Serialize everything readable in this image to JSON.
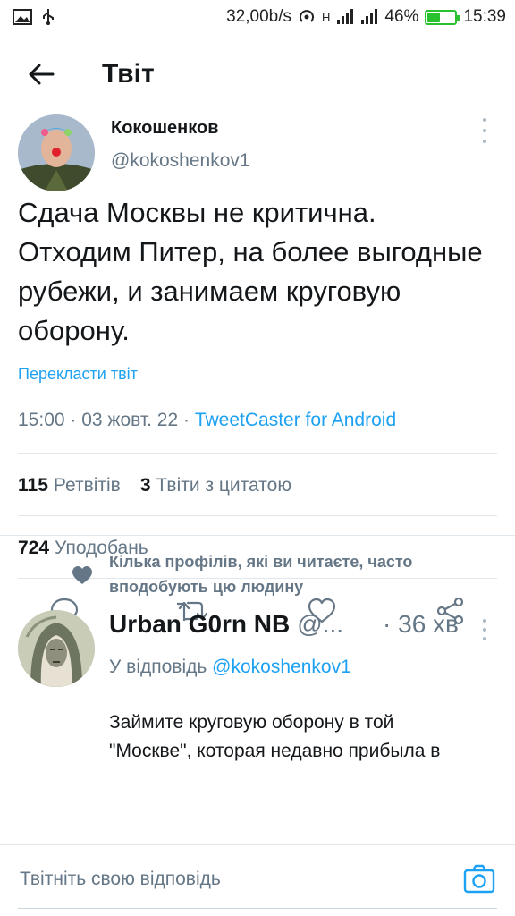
{
  "status_bar": {
    "speed": "32,00b/s",
    "network": "H",
    "battery_percent": "46%",
    "battery_level": 0.46,
    "time": "15:39"
  },
  "header": {
    "title": "Твіт"
  },
  "tweet": {
    "author_name": "Кокошенков",
    "author_handle": "@kokoshenkov1",
    "text": "Сдача Москвы не критична.\nОтходим Питер, на более выгодные рубежи, и занимаем круговую оборону.",
    "translate_label": "Перекласти твіт",
    "time": "15:00",
    "date": "03 жовт. 22",
    "separator": " · ",
    "client": "TweetCaster for Android",
    "retweets_count": "115",
    "retweets_label": "Ретвітів",
    "quotes_count": "3",
    "quotes_label": "Твіти з цитатою",
    "likes_count": "724",
    "likes_label": "Уподобань",
    "actions": [
      "reply-icon",
      "retweet-icon",
      "like-icon",
      "share-icon"
    ]
  },
  "social_context": {
    "icon": "heart-icon",
    "text": "Кілька профілів, які ви читаєте, часто вподобують цю людину"
  },
  "reply": {
    "name": "Urban G0rn NB",
    "handle": "@...",
    "time": "· 36 хв",
    "replying_prefix": "У відповідь",
    "replying_to": "@kokoshenkov1",
    "text": "Займите круговую оборону в той\n\"Москве\", которая недавно прибыла в"
  },
  "compose": {
    "placeholder": "Твітніть свою відповідь",
    "camera_icon": "camera-icon"
  },
  "colors": {
    "accent": "#1da1f2",
    "secondary_text": "#657786",
    "battery": "#27c22e"
  }
}
